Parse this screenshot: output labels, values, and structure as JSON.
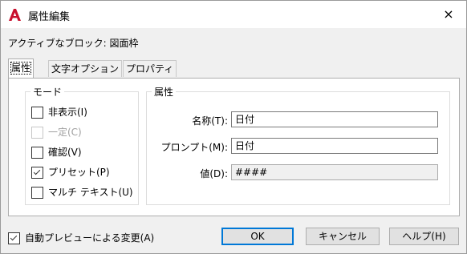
{
  "window": {
    "title": "属性編集",
    "close_icon": "×",
    "brand_color": "#c8102e"
  },
  "block": {
    "label": "アクティブなブロック: 図面枠"
  },
  "tabs": [
    {
      "label": "属性",
      "active": true
    },
    {
      "label": "文字オプション",
      "active": false
    },
    {
      "label": "プロパティ",
      "active": false
    }
  ],
  "mode": {
    "legend": "モード",
    "items": [
      {
        "label": "非表示(I)",
        "checked": false,
        "enabled": true
      },
      {
        "label": "一定(C)",
        "checked": false,
        "enabled": false
      },
      {
        "label": "確認(V)",
        "checked": false,
        "enabled": true
      },
      {
        "label": "プリセット(P)",
        "checked": true,
        "enabled": true
      },
      {
        "label": "マルチ テキスト(U)",
        "checked": false,
        "enabled": true
      }
    ]
  },
  "attribute": {
    "legend": "属性",
    "name_label": "名称(T):",
    "name_value": "日付",
    "prompt_label": "プロンプト(M):",
    "prompt_value": "日付",
    "value_label": "値(D):",
    "value_value": "####"
  },
  "auto_preview": {
    "label": "自動プレビューによる変更(A)",
    "checked": true
  },
  "buttons": {
    "ok": "OK",
    "cancel": "キャンセル",
    "help": "ヘルプ(H)"
  }
}
